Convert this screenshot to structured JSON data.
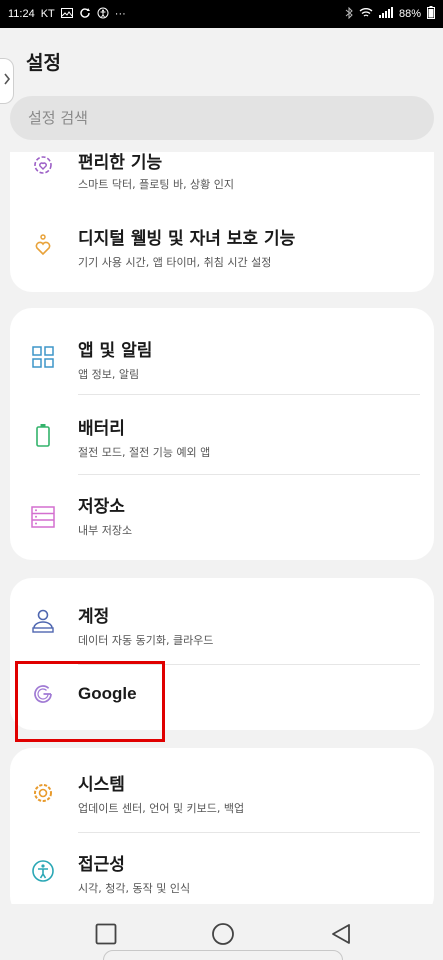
{
  "status": {
    "time": "11:24",
    "carrier": "KT",
    "battery": "88%",
    "icons_left": [
      "gallery-icon",
      "sync-icon",
      "accessibility-icon",
      "more-icon"
    ],
    "icons_right": [
      "bluetooth-icon",
      "wifi-icon",
      "signal-icon",
      "battery-icon"
    ]
  },
  "header": {
    "title": "설정",
    "search_placeholder": "설정 검색"
  },
  "groups": [
    {
      "items": [
        {
          "title": "편리한 기능",
          "subtitle": "스마트 닥터, 플로팅 바, 상황 인지",
          "icon": "gear-heart-icon",
          "color": "#9c5fc6"
        },
        {
          "title": "디지털 웰빙 및 자녀 보호 기능",
          "subtitle": "기기 사용 시간, 앱 타이머, 취침 시간 설정",
          "icon": "heart-person-icon",
          "color": "#e8a23a"
        }
      ]
    },
    {
      "items": [
        {
          "title": "앱 및 알림",
          "subtitle": "앱 정보, 알림",
          "icon": "apps-grid-icon",
          "color": "#3d95c9"
        },
        {
          "title": "배터리",
          "subtitle": "절전 모드, 절전 기능 예외 앱",
          "icon": "battery-icon",
          "color": "#33b36b"
        },
        {
          "title": "저장소",
          "subtitle": "내부 저장소",
          "icon": "storage-icon",
          "color": "#d36fcf"
        }
      ]
    },
    {
      "items": [
        {
          "title": "계정",
          "subtitle": "데이터 자동 동기화, 클라우드",
          "icon": "account-icon",
          "color": "#4f67b0"
        },
        {
          "title": "Google",
          "subtitle": "",
          "icon": "google-icon",
          "color": "#a07ad4"
        }
      ]
    },
    {
      "items": [
        {
          "title": "시스템",
          "subtitle": "업데이트 센터, 언어 및 키보드, 백업",
          "icon": "system-gear-icon",
          "color": "#e89a2c"
        },
        {
          "title": "접근성",
          "subtitle": "시각, 청각, 동작 및 인식",
          "icon": "accessibility-icon",
          "color": "#2aa7b5"
        }
      ]
    }
  ],
  "nav": {
    "icons": [
      "recent-apps-icon",
      "home-icon",
      "back-icon"
    ]
  }
}
